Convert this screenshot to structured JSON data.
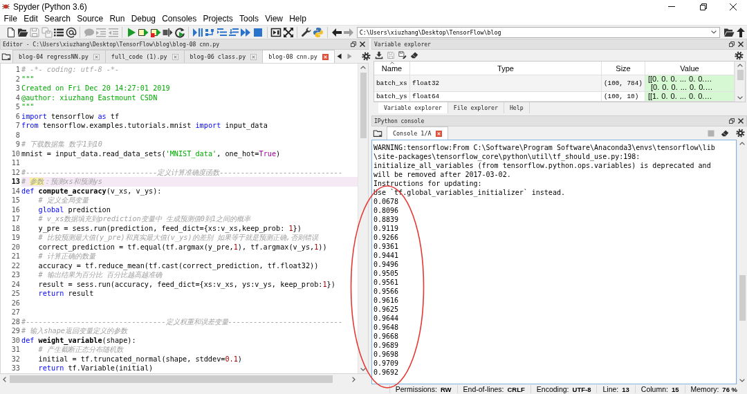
{
  "window": {
    "title": "Spyder (Python 3.6)"
  },
  "menu": [
    "File",
    "Edit",
    "Search",
    "Source",
    "Run",
    "Debug",
    "Consoles",
    "Projects",
    "Tools",
    "View",
    "Help"
  ],
  "toolbar": {
    "groups": [
      [
        {
          "kind": "new",
          "disabled": false
        },
        {
          "kind": "open",
          "disabled": false
        },
        {
          "kind": "save",
          "disabled": true
        },
        {
          "kind": "save-all",
          "disabled": true
        },
        {
          "kind": "browse",
          "disabled": false
        },
        {
          "kind": "at",
          "disabled": false
        }
      ],
      [
        {
          "kind": "comment",
          "disabled": true
        },
        {
          "kind": "indent",
          "disabled": true
        },
        {
          "kind": "unindent",
          "disabled": true
        }
      ],
      [
        {
          "kind": "run",
          "disabled": false
        },
        {
          "kind": "run-cell",
          "disabled": false
        },
        {
          "kind": "run-cell-advance",
          "disabled": false
        },
        {
          "kind": "run-selection",
          "disabled": false
        },
        {
          "kind": "rerun",
          "disabled": false
        }
      ],
      [
        {
          "kind": "debug",
          "disabled": false
        },
        {
          "kind": "step",
          "disabled": false
        },
        {
          "kind": "step-in",
          "disabled": false
        },
        {
          "kind": "step-return",
          "disabled": false
        },
        {
          "kind": "continue",
          "disabled": false
        },
        {
          "kind": "stop",
          "disabled": false
        }
      ],
      [
        {
          "kind": "maximize",
          "disabled": false
        },
        {
          "kind": "fullscreen",
          "disabled": false
        }
      ],
      [
        {
          "kind": "preferences",
          "disabled": false
        },
        {
          "kind": "python",
          "disabled": false
        }
      ],
      [
        {
          "kind": "back",
          "disabled": false
        },
        {
          "kind": "forward",
          "disabled": true
        }
      ]
    ],
    "path": "C:\\Users\\xiuzhang\\Desktop\\TensorFlow\\blog",
    "path_tools": [
      {
        "kind": "browse-dir",
        "disabled": false
      },
      {
        "kind": "parent-dir",
        "disabled": false
      }
    ]
  },
  "editor": {
    "title": "Editor - C:\\Users\\xiuzhang\\Desktop\\TensorFlow\\blog\\blog-08 cnn.py",
    "tabs": [
      {
        "label": "blog-04 regressNN.py",
        "selected": false
      },
      {
        "label": "full_code (1).py",
        "selected": false
      },
      {
        "label": "blog-06 class.py",
        "selected": false
      },
      {
        "label": "blog-08 cnn.py",
        "selected": true
      }
    ],
    "tab_nav": [
      {
        "kind": "tab-left",
        "disabled": false
      },
      {
        "kind": "tab-right",
        "disabled": true
      }
    ],
    "lines": [
      {
        "number": "1",
        "current": false,
        "tokens": [
          {
            "kind": "comment",
            "text": "# -*- coding: utf-8 -*-"
          }
        ]
      },
      {
        "number": "2",
        "current": false,
        "tokens": [
          {
            "kind": "string",
            "text": "\"\"\""
          }
        ]
      },
      {
        "number": "3",
        "current": false,
        "tokens": [
          {
            "kind": "string",
            "text": "Created on Fri Dec 20 14:27:01 2019"
          }
        ]
      },
      {
        "number": "4",
        "current": false,
        "tokens": [
          {
            "kind": "string",
            "text": "@author: xiuzhang Eastmount CSDN"
          }
        ]
      },
      {
        "number": "5",
        "current": false,
        "tokens": [
          {
            "kind": "string",
            "text": "\"\"\""
          }
        ]
      },
      {
        "number": "6",
        "current": false,
        "tokens": [
          {
            "kind": "keyword",
            "text": "import"
          },
          {
            "kind": "plain",
            "text": " tensorflow "
          },
          {
            "kind": "keyword",
            "text": "as"
          },
          {
            "kind": "plain",
            "text": " tf"
          }
        ]
      },
      {
        "number": "7",
        "current": false,
        "tokens": [
          {
            "kind": "keyword",
            "text": "from"
          },
          {
            "kind": "plain",
            "text": " tensorflow.examples.tutorials.mnist "
          },
          {
            "kind": "keyword",
            "text": "import"
          },
          {
            "kind": "plain",
            "text": " input_data"
          }
        ]
      },
      {
        "number": "8",
        "current": false
      },
      {
        "number": "9",
        "current": false,
        "tokens": [
          {
            "kind": "comment",
            "text": "# 下载数据集 数字1到10"
          }
        ]
      },
      {
        "number": "10",
        "current": false,
        "tokens": [
          {
            "kind": "plain",
            "text": "mnist = input_data.read_data_sets("
          },
          {
            "kind": "string",
            "text": "'MNIST_data'"
          },
          {
            "kind": "plain",
            "text": ", one_hot="
          },
          {
            "kind": "builtin",
            "text": "True"
          },
          {
            "kind": "plain",
            "text": ")"
          }
        ]
      },
      {
        "number": "11",
        "current": false
      },
      {
        "number": "12",
        "current": false,
        "tokens": [
          {
            "kind": "comment",
            "text": "#-------------------------------定义计算准确度函数-----------------------------"
          }
        ]
      },
      {
        "number": "13",
        "current": true,
        "tokens": [
          {
            "kind": "comment",
            "text": "# "
          },
          {
            "kind": "match",
            "text": "参数"
          },
          {
            "kind": "comment",
            "text": "：预测xs和预测ys"
          }
        ]
      },
      {
        "number": "14",
        "current": false,
        "tokens": [
          {
            "kind": "keyword",
            "text": "def"
          },
          {
            "kind": "def",
            "text": " compute_accuracy"
          },
          {
            "kind": "plain",
            "text": "(v_xs, v_ys):"
          }
        ],
        "children": [
          {
            "number": "15",
            "current": false,
            "tokens": [
              {
                "kind": "comment",
                "text": "# 定义全局变量"
              }
            ]
          },
          {
            "number": "16",
            "current": false,
            "tokens": [
              {
                "kind": "keyword",
                "text": "global"
              },
              {
                "kind": "plain",
                "text": " prediction"
              }
            ]
          },
          {
            "number": "17",
            "current": false,
            "tokens": [
              {
                "kind": "comment",
                "text": "# v_xs数据填充到prediction变量中 生成预测值0到1之间的概率"
              }
            ]
          },
          {
            "number": "18",
            "current": false,
            "tokens": [
              {
                "kind": "plain",
                "text": "y_pre = sess.run(prediction, feed_dict={xs:v_xs,keep_prob: "
              },
              {
                "kind": "number",
                "text": "1"
              },
              {
                "kind": "plain",
                "text": "})"
              }
            ]
          },
          {
            "number": "19",
            "current": false,
            "tokens": [
              {
                "kind": "comment",
                "text": "# 比较预测最大值(y_pre)和真实最大值(v_ys)的差别 如果等于就是预测正确,否则错误"
              }
            ]
          },
          {
            "number": "20",
            "current": false,
            "tokens": [
              {
                "kind": "plain",
                "text": "correct_prediction = tf.equal(tf.argmax(y_pre,"
              },
              {
                "kind": "number",
                "text": "1"
              },
              {
                "kind": "plain",
                "text": "), tf.argmax(v_ys,"
              },
              {
                "kind": "number",
                "text": "1"
              },
              {
                "kind": "plain",
                "text": "))"
              }
            ]
          },
          {
            "number": "21",
            "current": false,
            "tokens": [
              {
                "kind": "comment",
                "text": "# 计算正确的数量"
              }
            ]
          },
          {
            "number": "22",
            "current": false,
            "tokens": [
              {
                "kind": "plain",
                "text": "accuracy = tf.reduce_mean(tf.cast(correct_prediction, tf.float32))"
              }
            ]
          },
          {
            "number": "23",
            "current": false,
            "tokens": [
              {
                "kind": "comment",
                "text": "# 输出结果为百分比 百分比越高越准确"
              }
            ]
          },
          {
            "number": "24",
            "current": false,
            "tokens": [
              {
                "kind": "plain",
                "text": "result = sess.run(accuracy, feed_dict={xs:v_xs, ys:v_ys, keep_prob:"
              },
              {
                "kind": "number",
                "text": "1"
              },
              {
                "kind": "plain",
                "text": "})"
              }
            ]
          },
          {
            "number": "25",
            "current": false,
            "tokens": [
              {
                "kind": "keyword",
                "text": "return"
              },
              {
                "kind": "plain",
                "text": " result"
              }
            ]
          }
        ]
      },
      {
        "number": "26",
        "current": false
      },
      {
        "number": "27",
        "current": false
      },
      {
        "number": "28",
        "current": false,
        "tokens": [
          {
            "kind": "comment",
            "text": "#---------------------------------定义权重和误差变量---------------------------"
          }
        ]
      },
      {
        "number": "29",
        "current": false,
        "tokens": [
          {
            "kind": "comment",
            "text": "# 输入shape返回变量定义的参数"
          }
        ]
      },
      {
        "number": "30",
        "current": false,
        "tokens": [
          {
            "kind": "keyword",
            "text": "def"
          },
          {
            "kind": "def",
            "text": " weight_variable"
          },
          {
            "kind": "plain",
            "text": "(shape):"
          }
        ],
        "children": [
          {
            "number": "31",
            "current": false,
            "tokens": [
              {
                "kind": "comment",
                "text": "# 产生截断正态分布随机数"
              }
            ]
          },
          {
            "number": "32",
            "current": false,
            "tokens": [
              {
                "kind": "plain",
                "text": "initial = tf.truncated_normal(shape, stddev="
              },
              {
                "kind": "number",
                "text": "0.1"
              },
              {
                "kind": "plain",
                "text": ")"
              }
            ]
          },
          {
            "number": "33",
            "current": false,
            "tokens": [
              {
                "kind": "keyword",
                "text": "return"
              },
              {
                "kind": "plain",
                "text": " tf.Variable(initial)"
              }
            ]
          }
        ]
      }
    ]
  },
  "variable_explorer": {
    "title": "Variable explorer",
    "tools": [
      {
        "kind": "import",
        "disabled": false
      },
      {
        "kind": "save",
        "disabled": true
      },
      {
        "kind": "save-as",
        "disabled": false
      },
      {
        "kind": "reset",
        "disabled": false
      }
    ],
    "columns": [
      {
        "label": "Name",
        "sorted": true
      },
      {
        "label": "Type",
        "sorted": false
      },
      {
        "label": "Size",
        "sorted": false
      },
      {
        "label": "Value",
        "sorted": false
      }
    ],
    "rows": [
      {
        "name": "batch_xs",
        "type": "float32",
        "size": "(100, 784)",
        "value": "[[0. 0. 0. ... 0. 0.…\n [0. 0. 0. ... 0. 0.…"
      },
      {
        "name": "batch_ys",
        "type": "float64",
        "size": "(100, 10)",
        "value": "[[1. 0. 0. ... 0. 0.…"
      }
    ],
    "tabs": [
      {
        "label": "Variable explorer",
        "selected": true
      },
      {
        "label": "File explorer",
        "selected": false
      },
      {
        "label": "Help",
        "selected": false
      }
    ]
  },
  "console": {
    "title": "IPython console",
    "tabs": [
      {
        "label": "Console 1/A",
        "selected": true
      }
    ],
    "tools": [
      {
        "kind": "interrupt",
        "disabled": true
      },
      {
        "kind": "clear",
        "disabled": false
      }
    ],
    "output": [
      "WARNING:tensorflow:From C:\\Software\\Program Software\\Anaconda3\\envs\\tensorflow\\lib",
      "\\site-packages\\tensorflow_core\\python\\util\\tf_should_use.py:198:",
      "initialize_all_variables (from tensorflow.python.ops.variables) is deprecated and",
      "will be removed after 2017-03-02.",
      "Instructions for updating:",
      "Use `tf.global_variables_initializer` instead.",
      "0.0678",
      "0.8096",
      "0.8839",
      "0.9119",
      "0.9266",
      "0.9361",
      "0.9441",
      "0.9496",
      "0.9505",
      "0.9561",
      "0.9566",
      "0.9616",
      "0.9625",
      "0.9644",
      "0.9648",
      "0.9668",
      "0.9689",
      "0.9698",
      "0.9709",
      "0.9692"
    ]
  },
  "status_bar": [
    {
      "label": "Permissions:",
      "value": "RW"
    },
    {
      "label": "End-of-lines:",
      "value": "CRLF"
    },
    {
      "label": "Encoding:",
      "value": "UTF-8"
    },
    {
      "label": "Line:",
      "value": "13"
    },
    {
      "label": "Column:",
      "value": "15"
    },
    {
      "label": "Memory:",
      "value": "76 %"
    }
  ]
}
